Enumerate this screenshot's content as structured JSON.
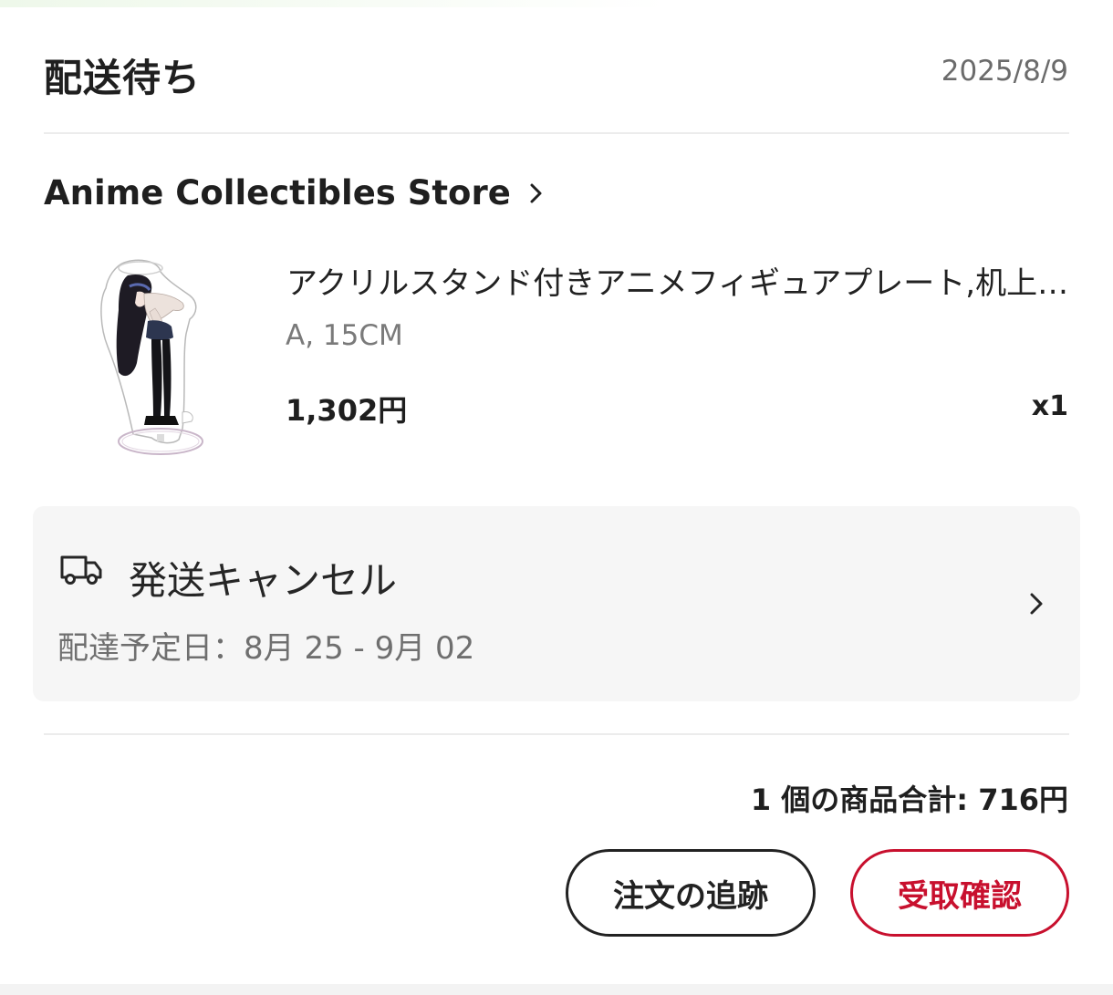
{
  "order": {
    "status_title": "配送待ち",
    "date": "2025/8/9"
  },
  "store": {
    "name": "Anime Collectibles Store",
    "chevron_icon": "chevron-right-icon"
  },
  "product": {
    "image_icon": "acrylic-stand-figure-image",
    "title": "アクリルスタンド付きアニメフィギュアプレート,机上の装飾品",
    "variant": "A, 15CM",
    "price": "1,302円",
    "quantity": "x1"
  },
  "shipping": {
    "icon": "truck-icon",
    "status": "発送キャンセル",
    "estimate": "配達予定日：8月 25 - 9月 02",
    "chevron_icon": "chevron-right-icon"
  },
  "summary": {
    "total_text": "1 個の商品合計: 716円"
  },
  "actions": {
    "track_label": "注文の追跡",
    "confirm_label": "受取確認"
  },
  "colors": {
    "accent": "#c8102e",
    "text_primary": "#1f1f1f",
    "text_secondary": "#7a7a7a",
    "card_background": "#f6f6f6"
  }
}
